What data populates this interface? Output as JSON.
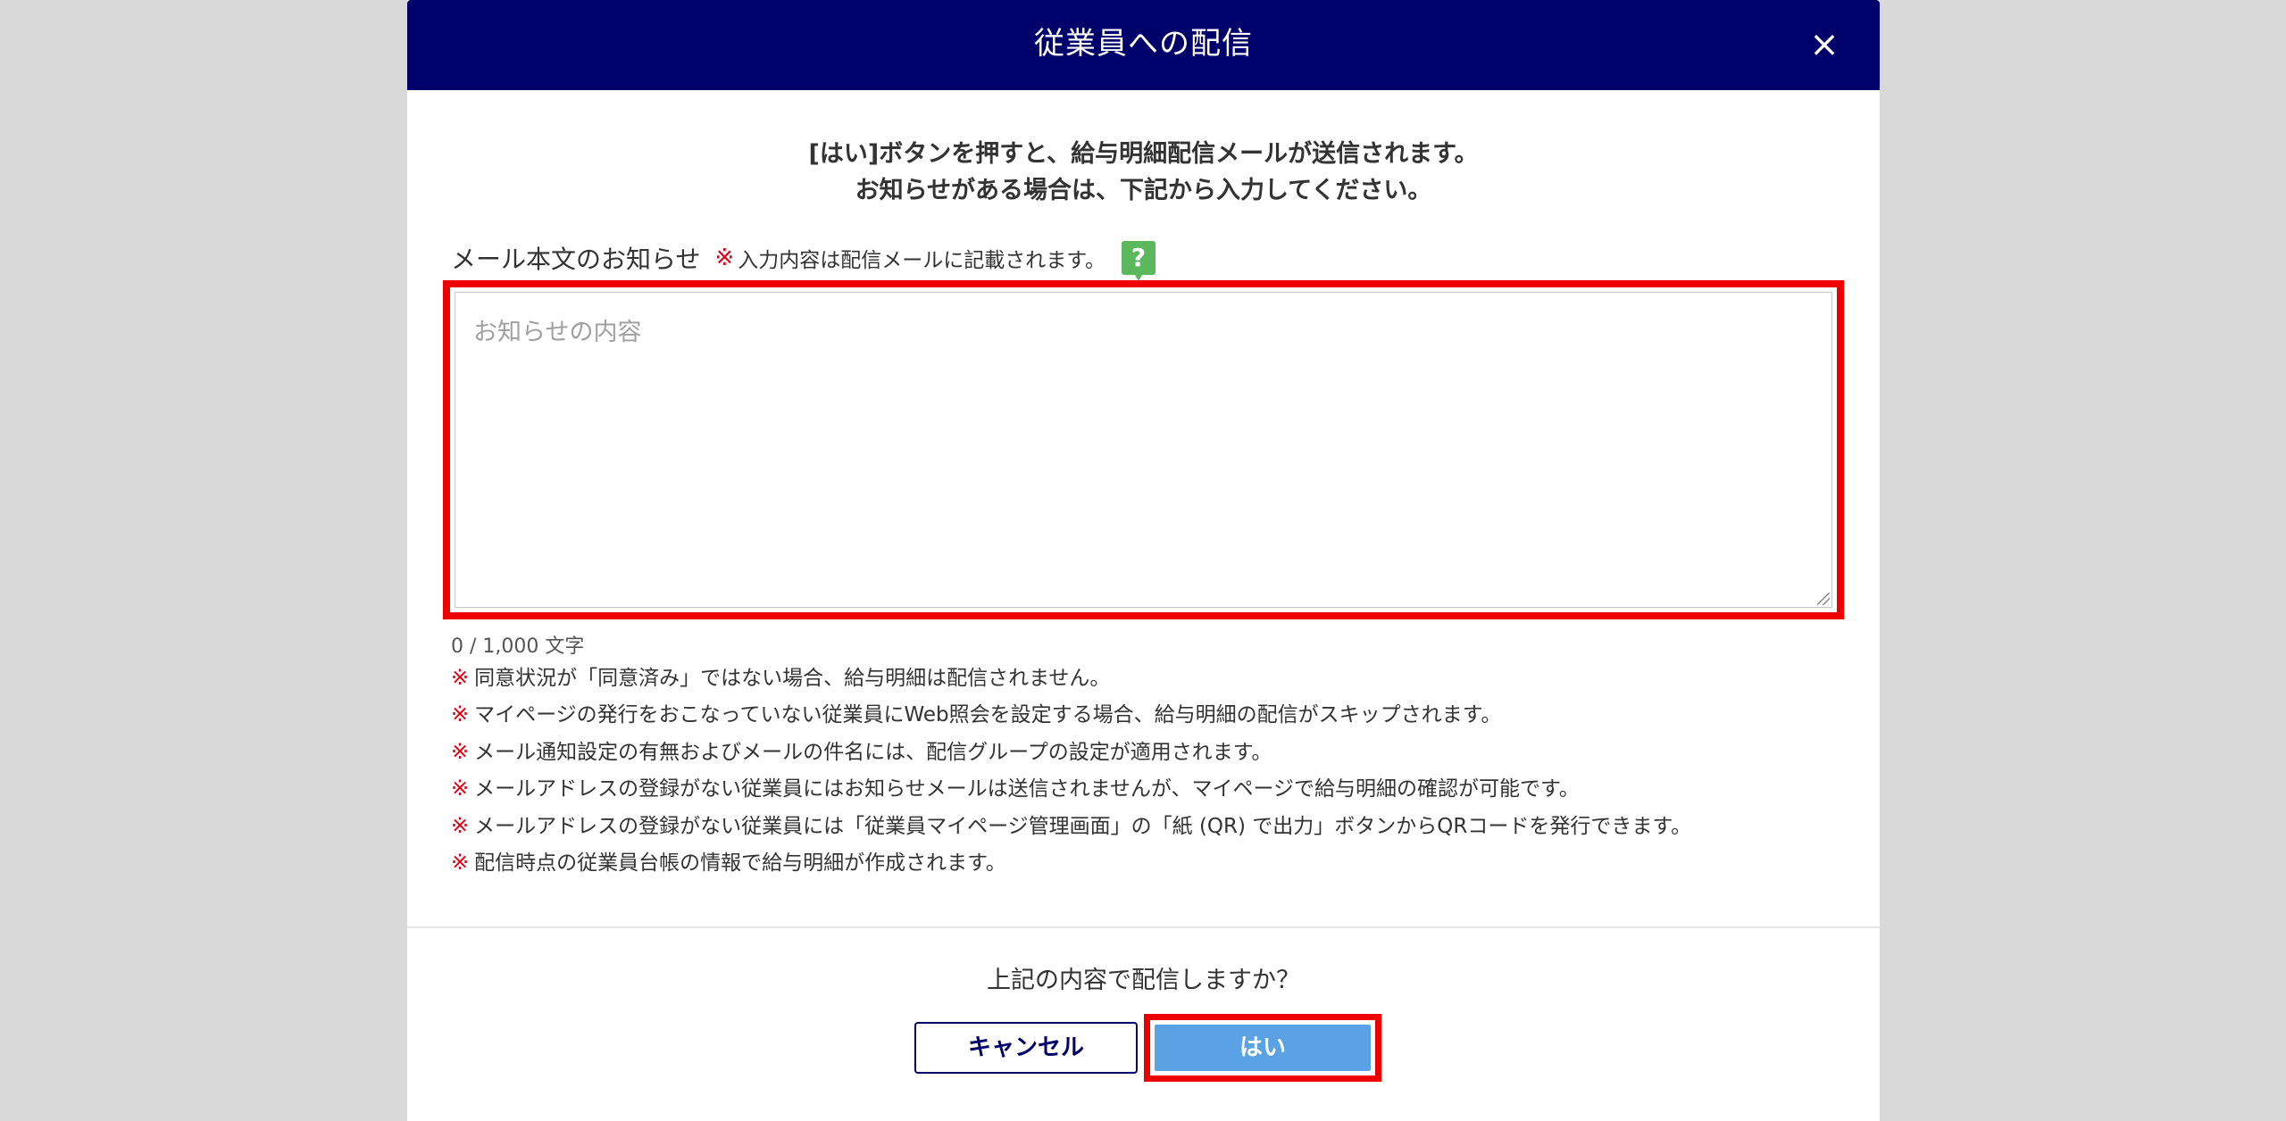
{
  "modal": {
    "title": "従業員への配信",
    "close_symbol": "×"
  },
  "intro": {
    "line1": "[はい]ボタンを押すと、給与明細配信メールが送信されます。",
    "line2": "お知らせがある場合は、下記から入力してください。"
  },
  "notice": {
    "label": "メール本文のお知らせ",
    "mark": "※",
    "note": "入力内容は配信メールに記載されます。",
    "help_symbol": "?",
    "placeholder": "お知らせの内容",
    "value": "",
    "counter": "0 / 1,000 文字"
  },
  "warnings": [
    {
      "mark": "※",
      "text": "同意状況が「同意済み」ではない場合、給与明細は配信されません。"
    },
    {
      "mark": "※",
      "text": "マイページの発行をおこなっていない従業員にWeb照会を設定する場合、給与明細の配信がスキップされます。"
    },
    {
      "mark": "※",
      "text": "メール通知設定の有無およびメールの件名には、配信グループの設定が適用されます。"
    },
    {
      "mark": "※",
      "text": "メールアドレスの登録がない従業員にはお知らせメールは送信されませんが、マイページで給与明細の確認が可能です。"
    },
    {
      "mark": "※",
      "text": "メールアドレスの登録がない従業員には「従業員マイページ管理画面」の「紙 (QR) で出力」ボタンからQRコードを発行できます。"
    },
    {
      "mark": "※",
      "text": "配信時点の従業員台帳の情報で給与明細が作成されます。"
    }
  ],
  "footer": {
    "question": "上記の内容で配信しますか？",
    "cancel_label": "キャンセル",
    "yes_label": "はい"
  },
  "colors": {
    "header_bg": "#00006b",
    "accent_blue": "#5aa2e4",
    "highlight_red": "#ee0000",
    "warning_mark": "#e60012",
    "help_green": "#5cb85c"
  }
}
